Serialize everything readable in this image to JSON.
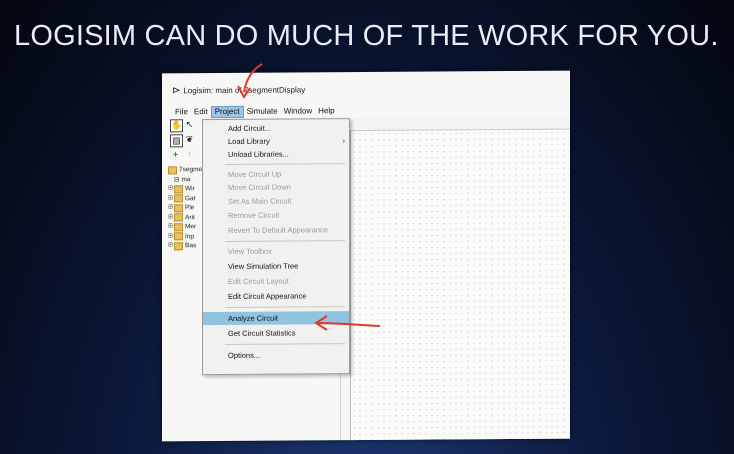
{
  "slide": {
    "title": "LOGISIM CAN DO MUCH OF THE WORK FOR YOU."
  },
  "window": {
    "title": "Logisim: main of 7segmentDisplay"
  },
  "menubar": [
    "File",
    "Edit",
    "Project",
    "Simulate",
    "Window",
    "Help"
  ],
  "tree": {
    "root": "7segme",
    "items": [
      {
        "label": "ma",
        "kind": "circuit"
      },
      {
        "label": "Wir",
        "kind": "folder"
      },
      {
        "label": "Gat",
        "kind": "folder"
      },
      {
        "label": "Ple",
        "kind": "folder"
      },
      {
        "label": "Arit",
        "kind": "folder"
      },
      {
        "label": "Mer",
        "kind": "folder"
      },
      {
        "label": "Inp",
        "kind": "folder"
      },
      {
        "label": "Bas",
        "kind": "folder"
      }
    ]
  },
  "project_menu": {
    "items": [
      {
        "label": "Add Circuit...",
        "enabled": true
      },
      {
        "label": "Load Library",
        "enabled": true,
        "submenu": true
      },
      {
        "label": "Unload Libraries...",
        "enabled": true
      },
      {
        "label": "Move Circuit Up",
        "enabled": false
      },
      {
        "label": "Move Circuit Down",
        "enabled": false
      },
      {
        "label": "Set As Main Circuit",
        "enabled": false
      },
      {
        "label": "Remove Circuit",
        "enabled": false
      },
      {
        "label": "Revert To Default Appearance",
        "enabled": false
      },
      {
        "label": "View Toolbox",
        "enabled": false
      },
      {
        "label": "View Simulation Tree",
        "enabled": true
      },
      {
        "label": "Edit Circuit Layout",
        "enabled": false
      },
      {
        "label": "Edit Circuit Appearance",
        "enabled": true
      },
      {
        "label": "Analyze Circuit",
        "enabled": true,
        "highlighted": true
      },
      {
        "label": "Get Circuit Statistics",
        "enabled": true
      },
      {
        "label": "Options...",
        "enabled": true
      }
    ]
  },
  "colors": {
    "highlight": "#8fc3df",
    "annotation": "#e0382a",
    "active_menu": "#9fc4e6"
  },
  "icons": {
    "logo": "logisim-gate-icon",
    "poke": "poke-hand-icon",
    "select": "select-arrow-icon",
    "add": "plus-icon",
    "submenu": "chevron-right-icon"
  }
}
